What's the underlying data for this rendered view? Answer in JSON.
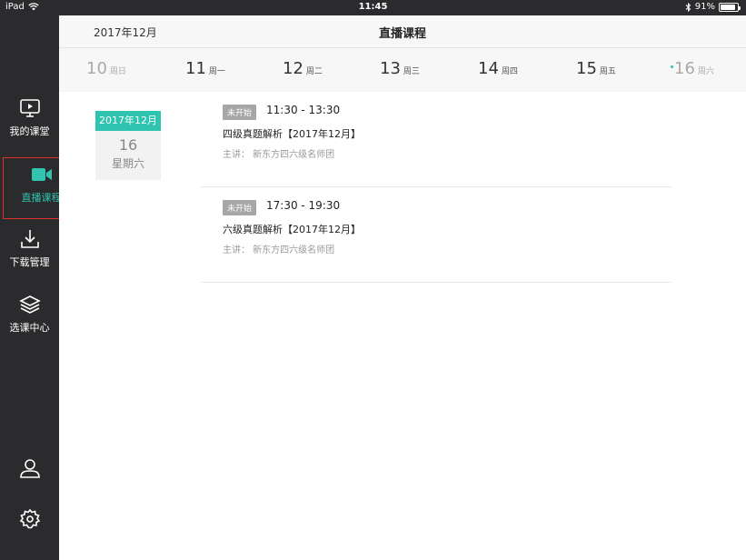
{
  "status_bar": {
    "device": "iPad",
    "time": "11:45",
    "battery": "91%",
    "battery_level": 0.91
  },
  "sidebar": {
    "items": [
      {
        "label": "我的课堂",
        "icon": "play-screen-icon"
      },
      {
        "label": "直播课程",
        "icon": "video-camera-icon"
      },
      {
        "label": "下载管理",
        "icon": "download-icon"
      },
      {
        "label": "选课中心",
        "icon": "layers-icon"
      }
    ],
    "bottom": [
      {
        "icon": "user-icon"
      },
      {
        "icon": "gear-icon"
      }
    ]
  },
  "header": {
    "month": "2017年12月",
    "title": "直播课程"
  },
  "days": [
    {
      "num": "10",
      "wk": "周日"
    },
    {
      "num": "11",
      "wk": "周一"
    },
    {
      "num": "12",
      "wk": "周二"
    },
    {
      "num": "13",
      "wk": "周三"
    },
    {
      "num": "14",
      "wk": "周四"
    },
    {
      "num": "15",
      "wk": "周五"
    },
    {
      "num": "16",
      "wk": "周六"
    }
  ],
  "date_card": {
    "month": "2017年12月",
    "day": "16",
    "weekday": "星期六"
  },
  "courses": [
    {
      "status": "未开始",
      "time": "11:30 - 13:30",
      "name": "四级真题解析【2017年12月】",
      "teacher": "主讲：  新东方四六级名师团"
    },
    {
      "status": "未开始",
      "time": "17:30 - 19:30",
      "name": "六级真题解析【2017年12月】",
      "teacher": "主讲：  新东方四六级名师团"
    }
  ],
  "colors": {
    "accent": "#2ec4b0",
    "sidebar_bg": "#2b2b2e",
    "highlight_border": "#e0302d",
    "status_badge": "#a6a6a8"
  }
}
